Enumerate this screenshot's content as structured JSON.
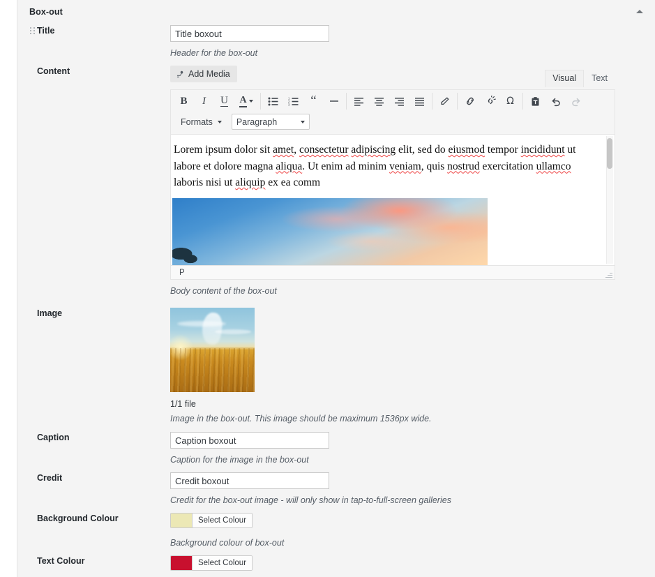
{
  "panel": {
    "title": "Box-out",
    "collapse_icon": "triangle-up-icon"
  },
  "fields": {
    "title": {
      "label": "Title",
      "value": "Title boxout",
      "placeholder": "",
      "description": "Header for the box-out",
      "handle_icon": "drag-handle-icon"
    },
    "content": {
      "label": "Content",
      "description": "Body content of the box-out",
      "add_media_label": "Add Media",
      "add_media_icon": "media-icon",
      "tabs": [
        {
          "label": "Visual",
          "active": true
        },
        {
          "label": "Text",
          "active": false
        }
      ],
      "toolbar_row1": [
        {
          "name": "bold-icon",
          "glyph": "B",
          "disabled": false
        },
        {
          "name": "italic-icon",
          "glyph": "I",
          "disabled": false
        },
        {
          "name": "underline-icon",
          "glyph": "U",
          "disabled": false
        },
        {
          "name": "text-color-icon",
          "glyph": "A",
          "disabled": false
        },
        {
          "name": "bulleted-list-icon",
          "glyph": "",
          "disabled": false
        },
        {
          "name": "numbered-list-icon",
          "glyph": "",
          "disabled": false
        },
        {
          "name": "blockquote-icon",
          "glyph": "“",
          "disabled": false
        },
        {
          "name": "horizontal-rule-icon",
          "glyph": "–",
          "disabled": false
        },
        {
          "name": "align-left-icon",
          "glyph": "",
          "disabled": false
        },
        {
          "name": "align-center-icon",
          "glyph": "",
          "disabled": false
        },
        {
          "name": "align-right-icon",
          "glyph": "",
          "disabled": false
        },
        {
          "name": "align-justify-icon",
          "glyph": "",
          "disabled": false
        },
        {
          "name": "clear-formatting-icon",
          "glyph": "",
          "disabled": false
        },
        {
          "name": "insert-link-icon",
          "glyph": "",
          "disabled": false
        },
        {
          "name": "remove-link-icon",
          "glyph": "",
          "disabled": false
        },
        {
          "name": "special-character-icon",
          "glyph": "Ω",
          "disabled": false
        },
        {
          "name": "paste-as-text-icon",
          "glyph": "",
          "disabled": false
        },
        {
          "name": "undo-icon",
          "glyph": "↶",
          "disabled": false
        },
        {
          "name": "redo-icon",
          "glyph": "↷",
          "disabled": true
        }
      ],
      "formats_label": "Formats",
      "block_format_value": "Paragraph",
      "body_text_runs": [
        {
          "t": "Lorem ipsum dolor sit ",
          "sp": false
        },
        {
          "t": "amet",
          "sp": true
        },
        {
          "t": ", ",
          "sp": false
        },
        {
          "t": "consectetur",
          "sp": true
        },
        {
          "t": " ",
          "sp": false
        },
        {
          "t": "adipiscing",
          "sp": true
        },
        {
          "t": " elit, sed do ",
          "sp": false
        },
        {
          "t": "eiusmod",
          "sp": true
        },
        {
          "t": " tempor ",
          "sp": false
        },
        {
          "t": "incididunt",
          "sp": true
        },
        {
          "t": " ut labore et dolore magna ",
          "sp": false
        },
        {
          "t": "aliqua",
          "sp": true
        },
        {
          "t": ". Ut enim ad minim ",
          "sp": false
        },
        {
          "t": "veniam",
          "sp": true
        },
        {
          "t": ", quis ",
          "sp": false
        },
        {
          "t": "nostrud",
          "sp": true
        },
        {
          "t": " exercitation ",
          "sp": false
        },
        {
          "t": "ullamco",
          "sp": true
        },
        {
          "t": " laboris nisi ut ",
          "sp": false
        },
        {
          "t": "aliquip",
          "sp": true
        },
        {
          "t": " ex ea comm",
          "sp": false
        }
      ],
      "embedded_image_name": "sunset-sky-image",
      "statusbar_path": "P",
      "resize_handle_name": "editor-resize-handle"
    },
    "image": {
      "label": "Image",
      "thumbnail_name": "wheat-field-sunset-thumbnail",
      "file_count": "1/1 file",
      "description": "Image in the box-out. This image should be maximum 1536px wide."
    },
    "caption": {
      "label": "Caption",
      "value": "Caption boxout",
      "description": "Caption for the image in the box-out"
    },
    "credit": {
      "label": "Credit",
      "value": "Credit boxout",
      "description": "Credit for the box-out image - will only show in tap-to-full-screen galleries"
    },
    "background_colour": {
      "label": "Background Colour",
      "button_label": "Select Colour",
      "swatch": "#ece8b5",
      "description": "Background colour of box-out"
    },
    "text_colour": {
      "label": "Text Colour",
      "button_label": "Select Colour",
      "swatch": "#c8102e",
      "description": ""
    }
  }
}
